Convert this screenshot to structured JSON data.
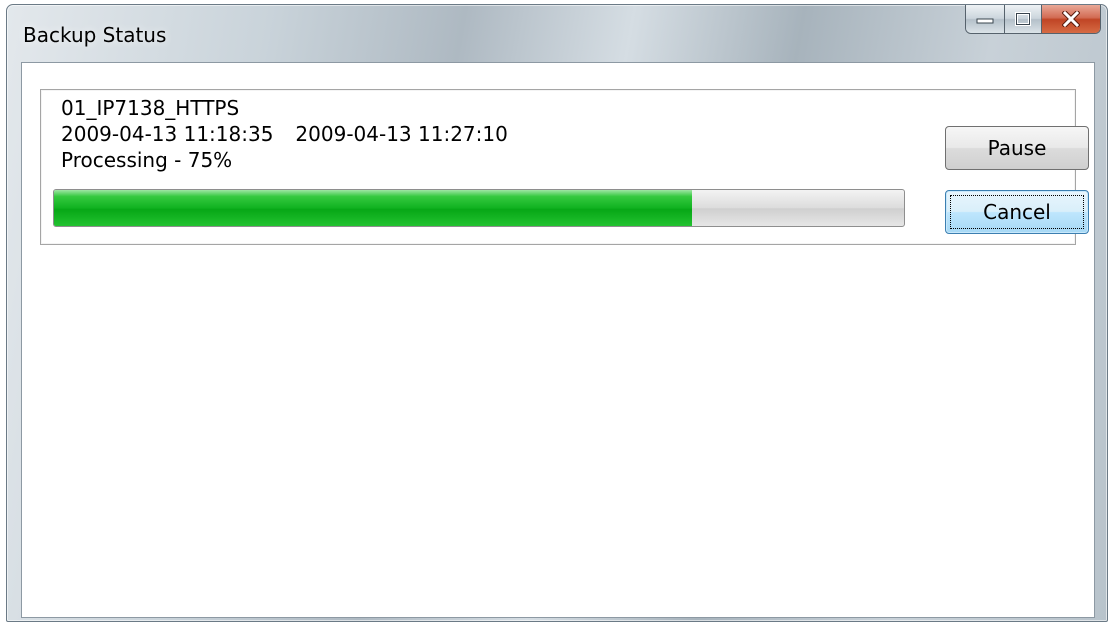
{
  "window": {
    "title": "Backup Status",
    "controls": {
      "minimize_icon": "minimize-icon",
      "maximize_icon": "maximize-icon",
      "close_icon": "close-icon"
    }
  },
  "job": {
    "name": "01_IP7138_HTTPS",
    "start_time": "2009-04-13 11:18:35",
    "end_time": "2009-04-13 11:27:10",
    "status_text": "Processing - 75%",
    "progress_fraction": 0.75
  },
  "buttons": {
    "pause_label": "Pause",
    "cancel_label": "Cancel"
  },
  "colors": {
    "progress_fill": "#10b220",
    "close_button": "#c04525"
  }
}
